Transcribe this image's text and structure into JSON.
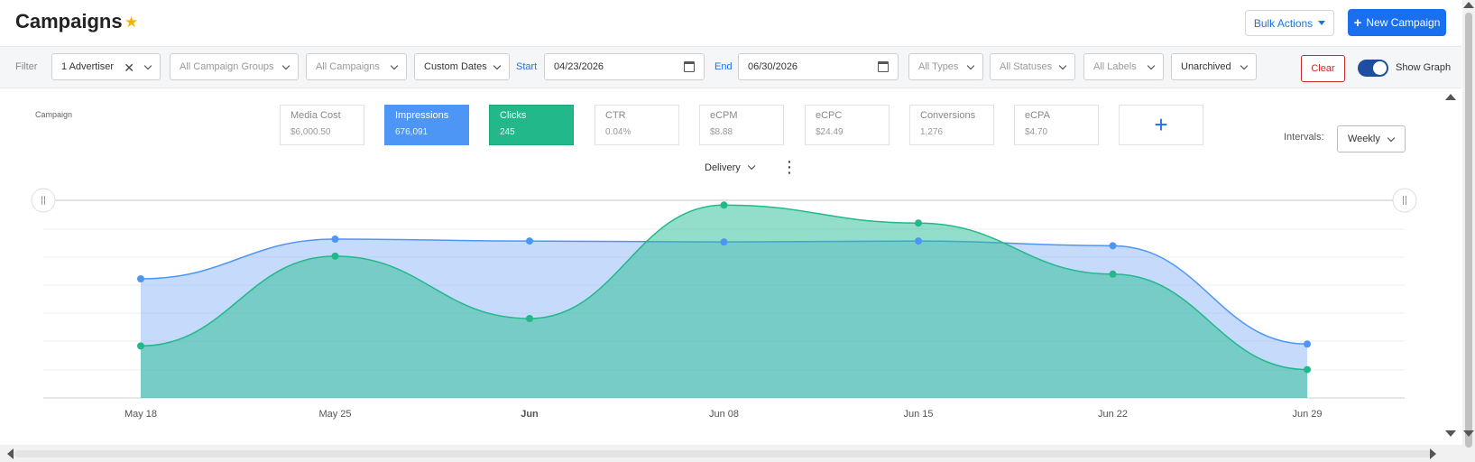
{
  "header": {
    "title": "Campaigns",
    "star_icon": "star-icon",
    "bulk_actions_label": "Bulk Actions",
    "new_campaign_label": "New Campaign"
  },
  "filters": {
    "label": "Filter",
    "advertiser": "1 Advertiser",
    "campaign_groups": "All Campaign Groups",
    "campaigns": "All Campaigns",
    "date_mode": "Custom Dates",
    "start_label": "Start",
    "start_value": "04/23/2026",
    "end_label": "End",
    "end_value": "06/30/2026",
    "types": "All Types",
    "statuses": "All Statuses",
    "labels": "All Labels",
    "archived": "Unarchived",
    "clear_label": "Clear",
    "show_graph_label": "Show Graph",
    "show_graph_on": true
  },
  "metrics": {
    "campaign_label": "Campaign",
    "cards": [
      {
        "label": "Media Cost",
        "value": "$6,000.50",
        "state": "none"
      },
      {
        "label": "Impressions",
        "value": "676,091",
        "state": "blue"
      },
      {
        "label": "Clicks",
        "value": "245",
        "state": "green"
      },
      {
        "label": "CTR",
        "value": "0.04%",
        "state": "none"
      },
      {
        "label": "eCPM",
        "value": "$8.88",
        "state": "none"
      },
      {
        "label": "eCPC",
        "value": "$24.49",
        "state": "none"
      },
      {
        "label": "Conversions",
        "value": "1,276",
        "state": "none"
      },
      {
        "label": "eCPA",
        "value": "$4.70",
        "state": "none"
      }
    ],
    "add_label": "+"
  },
  "graph_controls": {
    "intervals_label": "Intervals:",
    "interval_value": "Weekly",
    "delivery_label": "Delivery",
    "more_icon": "⋮"
  },
  "colors": {
    "impressions": "#4d96f6",
    "clicks": "#23b88a",
    "accent": "#1a6ff0"
  },
  "chart_data": {
    "type": "area",
    "x": [
      "May 18",
      "May 25",
      "Jun",
      "Jun 08",
      "Jun 15",
      "Jun 22",
      "Jun 29"
    ],
    "bold_ticks": [
      "Jun"
    ],
    "series": [
      {
        "name": "Impressions",
        "color": "#4d96f6",
        "values": [
          126,
          168,
          166,
          165,
          166,
          161,
          57
        ]
      },
      {
        "name": "Clicks",
        "color": "#23b88a",
        "values": [
          55,
          150,
          84,
          204,
          185,
          131,
          30
        ]
      }
    ],
    "ylim": [
      0,
      210
    ],
    "grid": true,
    "legend": "none"
  }
}
